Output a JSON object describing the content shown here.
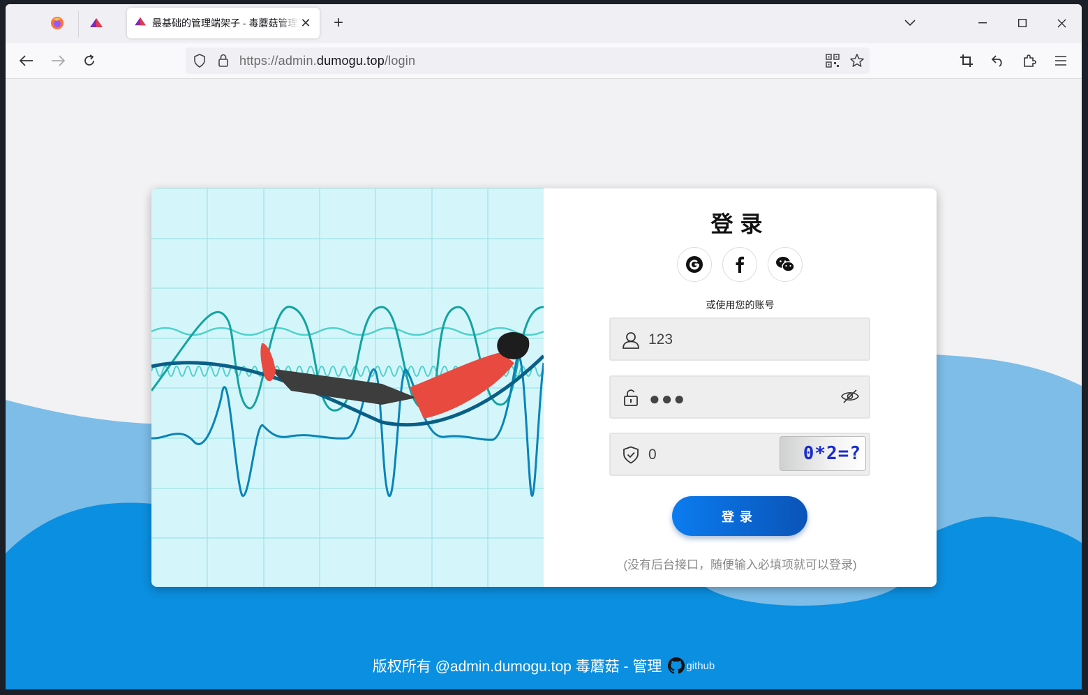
{
  "browser": {
    "active_tab_title": "最基础的管理端架子 - 毒蘑菇管理",
    "tab_close": "✕",
    "new_tab": "+",
    "url_prefix": "https://admin.",
    "url_domain": "dumogu.top",
    "url_path": "/login"
  },
  "login": {
    "title": "登录",
    "or_text": "或使用您的账号",
    "username_value": "123",
    "password_dots": "●●●",
    "captcha_value": "0",
    "captcha_image_text": "0*2=?",
    "button_label": "登录",
    "hint": "(没有后台接口，随便输入必填项就可以登录)",
    "social": [
      {
        "name": "google-icon",
        "glyph": "G"
      },
      {
        "name": "facebook-icon",
        "glyph": "f"
      },
      {
        "name": "wechat-icon",
        "glyph": ""
      }
    ]
  },
  "footer": {
    "copyright": "版权所有 @admin.dumogu.top 毒蘑菇 - 管理",
    "github_label": "github"
  },
  "colors": {
    "accent": "#0a6fe0",
    "wave_light": "#7dbde8",
    "wave_dark": "#0b8fe0",
    "illustration_bg": "#d4f6fb"
  }
}
